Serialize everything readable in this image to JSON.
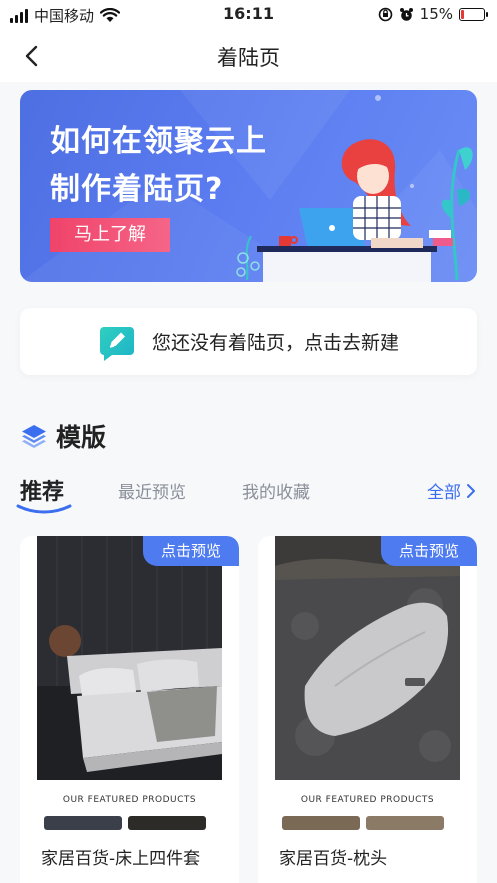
{
  "status_bar": {
    "carrier": "中国移动",
    "time": "16:11",
    "battery": "15%",
    "battery_level": 0.15
  },
  "nav": {
    "title": "着陆页",
    "back_icon": "chevron-left-icon"
  },
  "banner": {
    "line1": "如何在领聚云上",
    "line2": "制作着陆页?",
    "button_label": "马上了解"
  },
  "empty_state": {
    "icon": "edit-icon",
    "text": "您还没有着陆页，点击去新建"
  },
  "templates": {
    "title": "模版",
    "icon": "layers-icon",
    "tabs": [
      {
        "label": "推荐",
        "active": true
      },
      {
        "label": "最近预览",
        "active": false
      },
      {
        "label": "我的收藏",
        "active": false
      }
    ],
    "all_label": "全部",
    "cards": [
      {
        "name": "家居百货-床上四件套",
        "badge": "点击预览",
        "caption": "OUR FEATURED PRODUCTS"
      },
      {
        "name": "家居百货-枕头",
        "badge": "点击预览",
        "caption": "OUR FEATURED PRODUCTS"
      }
    ]
  },
  "colors": {
    "accent": "#4e7cf0",
    "banner_button": "#f0436a",
    "empty_icon": "#2fcfc0"
  }
}
